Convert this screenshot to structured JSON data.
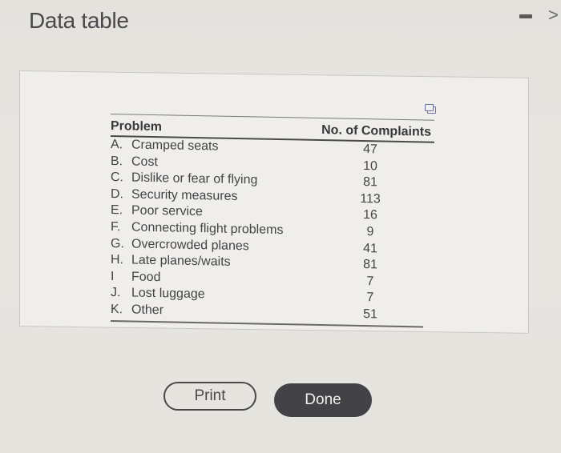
{
  "window": {
    "title": "Data table",
    "minimize_icon": "minimize-icon",
    "next_icon": "chevron-right-icon",
    "next_glyph": ">"
  },
  "table": {
    "copy_icon": "copy-icon",
    "headers": {
      "problem": "Problem",
      "count": "No. of Complaints"
    },
    "rows": [
      {
        "letter": "A.",
        "problem": "Cramped seats",
        "count": "47"
      },
      {
        "letter": "B.",
        "problem": "Cost",
        "count": "10"
      },
      {
        "letter": "C.",
        "problem": "Dislike or fear of flying",
        "count": "81"
      },
      {
        "letter": "D.",
        "problem": "Security measures",
        "count": "113"
      },
      {
        "letter": "E.",
        "problem": "Poor service",
        "count": "16"
      },
      {
        "letter": "F.",
        "problem": "Connecting flight problems",
        "count": "9"
      },
      {
        "letter": "G.",
        "problem": "Overcrowded planes",
        "count": "41"
      },
      {
        "letter": "H.",
        "problem": "Late planes/waits",
        "count": "81"
      },
      {
        "letter": "I",
        "problem": "Food",
        "count": "7"
      },
      {
        "letter": "J.",
        "problem": "Lost luggage",
        "count": "7"
      },
      {
        "letter": "K.",
        "problem": "Other",
        "count": "51"
      }
    ]
  },
  "buttons": {
    "print_label": "Print",
    "done_label": "Done"
  }
}
